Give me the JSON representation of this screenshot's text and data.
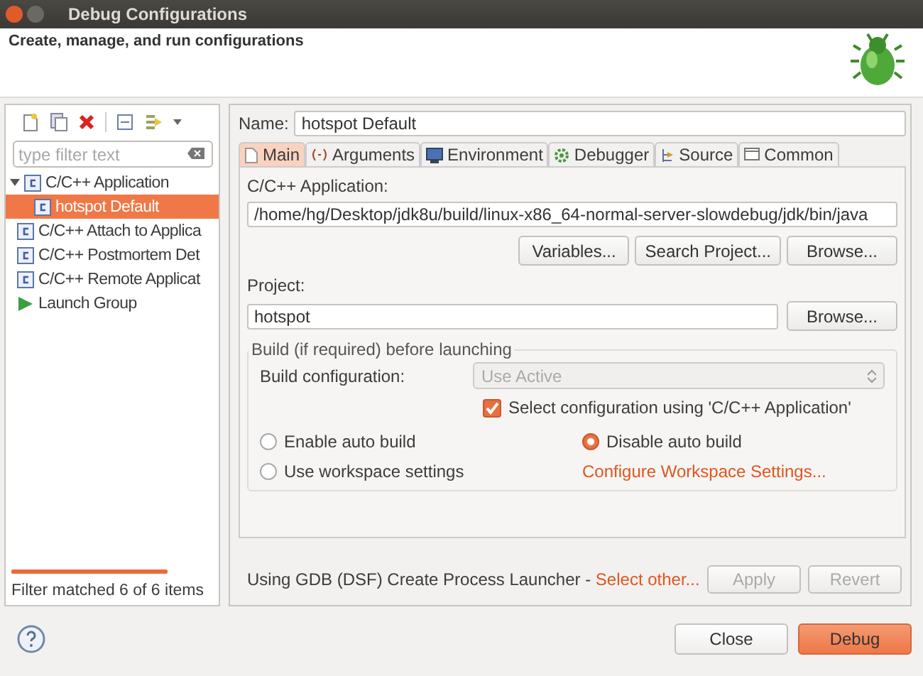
{
  "window": {
    "title": "Debug Configurations"
  },
  "header": {
    "title": "Create, manage, and run configurations"
  },
  "filter": {
    "placeholder": "type filter text"
  },
  "tree": [
    {
      "label": "C/C++ Application",
      "kind": "c-config",
      "expanded": true,
      "selected": false,
      "children": [
        {
          "label": "hotspot Default",
          "kind": "c-config",
          "selected": true
        }
      ]
    },
    {
      "label": "C/C++ Attach to Applica",
      "kind": "c-config",
      "selected": false
    },
    {
      "label": "C/C++ Postmortem Det",
      "kind": "c-config",
      "selected": false
    },
    {
      "label": "C/C++ Remote Applicat",
      "kind": "c-config",
      "selected": false
    },
    {
      "label": "Launch Group",
      "kind": "launch-group",
      "selected": false
    }
  ],
  "filter_status": "Filter matched 6 of 6 items",
  "name": {
    "label": "Name:",
    "value": "hotspot Default"
  },
  "tabs": [
    {
      "label": "Main",
      "selected": true
    },
    {
      "label": "Arguments",
      "selected": false
    },
    {
      "label": "Environment",
      "selected": false
    },
    {
      "label": "Debugger",
      "selected": false
    },
    {
      "label": "Source",
      "selected": false
    },
    {
      "label": "Common",
      "selected": false
    }
  ],
  "application": {
    "label": "C/C++ Application:",
    "value": "/home/hg/Desktop/jdk8u/build/linux-x86_64-normal-server-slowdebug/jdk/bin/java",
    "buttons": [
      "Variables...",
      "Search Project...",
      "Browse..."
    ]
  },
  "project": {
    "label": "Project:",
    "value": "hotspot",
    "button": "Browse..."
  },
  "build": {
    "title": "Build (if required) before launching",
    "config_label": "Build configuration:",
    "config_value": "Use Active",
    "config_disabled": true,
    "checkbox": {
      "label": "Select configuration using 'C/C++ Application'",
      "checked": true
    },
    "radios": [
      {
        "label": "Enable auto build",
        "selected": false
      },
      {
        "label": "Disable auto build",
        "selected": true
      },
      {
        "label": "Use workspace settings",
        "selected": false
      }
    ],
    "link": "Configure Workspace Settings..."
  },
  "launcher": {
    "text": "Using GDB (DSF) Create Process Launcher -",
    "link": "Select other..."
  },
  "actions": [
    {
      "label": "Apply",
      "disabled": true
    },
    {
      "label": "Revert",
      "disabled": true
    }
  ],
  "footer": [
    {
      "label": "Close",
      "kind": "normal"
    },
    {
      "label": "Debug",
      "kind": "default"
    }
  ]
}
